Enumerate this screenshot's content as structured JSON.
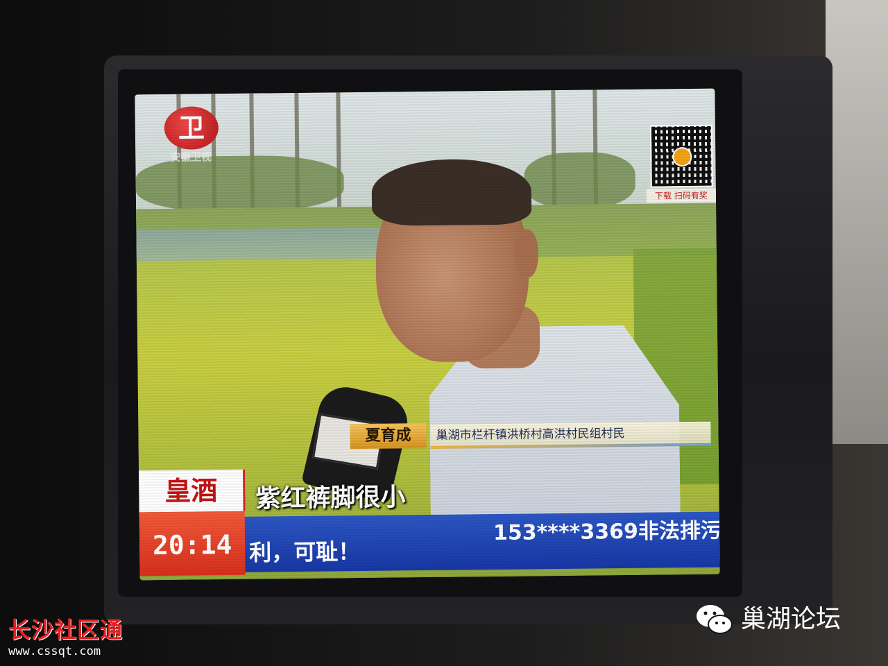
{
  "broadcast": {
    "channel_logo_mark": "卫",
    "channel_logo_caption": "安徽卫视",
    "qr_caption": "下载 扫码有奖",
    "interviewee_name": "夏育成",
    "interviewee_title": "巢湖市栏杆镇洪桥村高洪村民组村民",
    "subtitle": "紫红裤脚很小",
    "ad_text": "皇酒",
    "clock": "20:14",
    "ticker_left": "利，可耻！",
    "ticker_right": "153****3369非法排污"
  },
  "watermarks": {
    "left_brand": "长沙社区通",
    "left_url": "www.cssqt.com",
    "right_brand": "巢湖论坛",
    "right_icon": "wechat-icon"
  },
  "colors": {
    "ticker_blue": "#1f44b8",
    "clock_red": "#e2432a",
    "name_gold": "#e8a83a",
    "watermark_red": "#e62020"
  }
}
